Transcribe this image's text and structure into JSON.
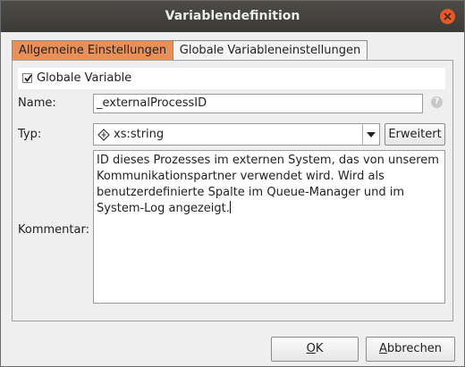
{
  "window": {
    "title": "Variablendefinition"
  },
  "tabs": [
    {
      "label": "Allgemeine Einstellungen",
      "active": true
    },
    {
      "label": "Globale Variableneinstellungen",
      "active": false
    }
  ],
  "form": {
    "global_checkbox": {
      "label": "Globale Variable",
      "checked": true
    },
    "name": {
      "label": "Name:",
      "value": "_externalProcessID"
    },
    "type": {
      "label": "Typ:",
      "value": "xs:string",
      "icon": "type-diamond-icon"
    },
    "advanced_button": "Erweitert",
    "comment": {
      "label": "Kommentar:",
      "value": "ID dieses Prozesses im externen System, das von unserem\nKommunikationspartner verwendet wird. Wird als\nbenutzerdefinierte Spalte im Queue-Manager und im\nSystem-Log angezeigt."
    }
  },
  "footer": {
    "ok": "OK",
    "cancel": "Abbrechen"
  },
  "colors": {
    "titlebar": "#3f3d39",
    "active_tab": "#e8905a",
    "close_button": "#e05a2a",
    "dialog_bg": "#efefef"
  }
}
